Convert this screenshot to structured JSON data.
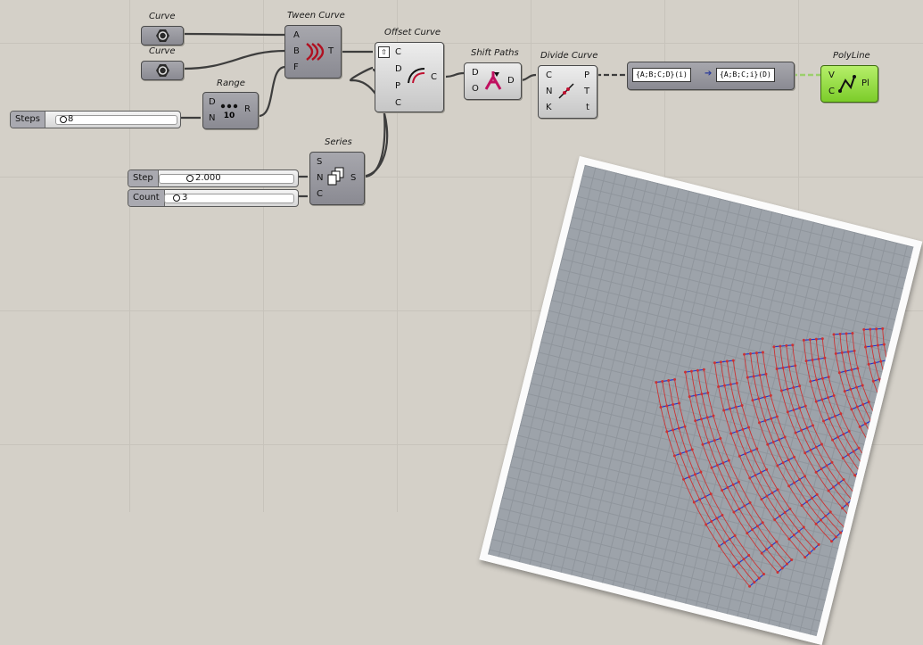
{
  "components": {
    "curve1": {
      "title": "Curve"
    },
    "curve2": {
      "title": "Curve"
    },
    "tween": {
      "title": "Tween Curve",
      "inputs": [
        "A",
        "B",
        "F"
      ],
      "output": "T"
    },
    "range": {
      "title": "Range",
      "inputs": [
        "D",
        "N"
      ],
      "output": "R",
      "icon_text": "10"
    },
    "offset": {
      "title": "Offset Curve",
      "inputs": [
        "C",
        "D",
        "P",
        "C"
      ],
      "output": "C"
    },
    "shift": {
      "title": "Shift Paths",
      "inputs": [
        "D",
        "O"
      ],
      "output": "D"
    },
    "divide": {
      "title": "Divide Curve",
      "inputs": [
        "C",
        "N",
        "K"
      ],
      "outputs": [
        "P",
        "T",
        "t"
      ]
    },
    "series": {
      "title": "Series",
      "inputs": [
        "S",
        "N",
        "C"
      ],
      "output": "S"
    },
    "polyline": {
      "title": "PolyLine",
      "inputs": [
        "V",
        "C"
      ],
      "output": "Pl"
    },
    "relay": {
      "from_path": "{A;B;C;D}(i)",
      "to_path": "{A;B;C;i}(D)"
    }
  },
  "sliders": {
    "steps": {
      "label": "Steps",
      "value": "8"
    },
    "step": {
      "label": "Step",
      "value": "2.000"
    },
    "count": {
      "label": "Count",
      "value": "3"
    }
  },
  "colors": {
    "canvas": "#d4d0c8",
    "polyline": "#8fe040",
    "grid_red": "#cc3333",
    "grid_blue": "#2233cc"
  },
  "icons": [
    "curve-param-icon",
    "tween-curve-icon",
    "range-icon",
    "offset-curve-icon",
    "shift-paths-icon",
    "divide-curve-icon",
    "series-icon",
    "polyline-icon",
    "flatten-icon"
  ]
}
